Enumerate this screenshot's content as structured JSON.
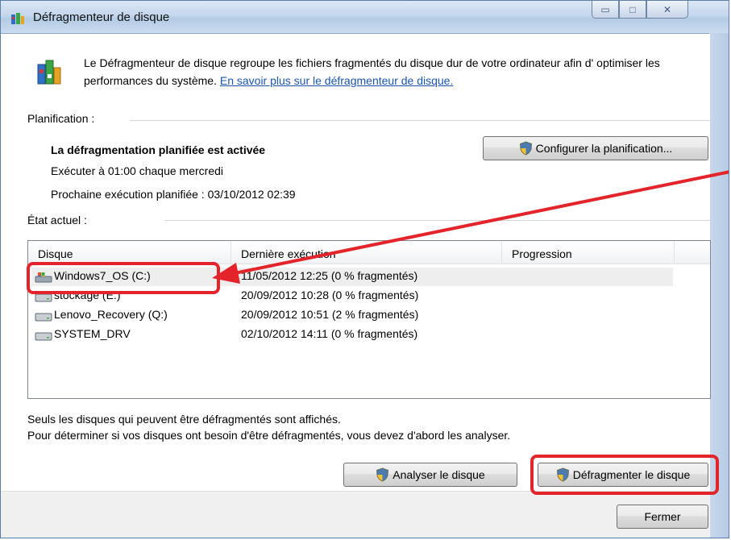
{
  "window": {
    "title": "Défragmenteur de disque",
    "controls": {
      "minimize": "▭",
      "maximize": "□",
      "close": "✕"
    }
  },
  "intro": {
    "text": "Le Défragmenteur de disque regroupe les fichiers fragmentés du disque dur de votre ordinateur afin d' optimiser les performances du système.",
    "link": "En savoir plus sur le défragmenteur de disque."
  },
  "schedule": {
    "label": "Planification :",
    "status": "La défragmentation planifiée est activée",
    "run_at": "Exécuter à 01:00 chaque mercredi",
    "next_run": "Prochaine exécution planifiée : 03/10/2012 02:39",
    "configure_button": "Configurer la planification..."
  },
  "current_state": {
    "label": "État actuel :",
    "columns": [
      "Disque",
      "Dernière exécution",
      "Progression"
    ],
    "rows": [
      {
        "disk": "Windows7_OS (C:)",
        "last_run": "11/05/2012 12:25 (0 % fragmentés)",
        "progress": "",
        "icon": "system-drive-icon",
        "selected": true
      },
      {
        "disk": "stockage (E:)",
        "last_run": "20/09/2012 10:28 (0 % fragmentés)",
        "progress": "",
        "icon": "drive-icon"
      },
      {
        "disk": "Lenovo_Recovery (Q:)",
        "last_run": "20/09/2012 10:51 (2 % fragmentés)",
        "progress": "",
        "icon": "drive-icon"
      },
      {
        "disk": "SYSTEM_DRV",
        "last_run": "02/10/2012 14:11 (0 % fragmentés)",
        "progress": "",
        "icon": "drive-icon"
      }
    ]
  },
  "notes": {
    "line1": "Seuls les disques qui peuvent être défragmentés sont affichés.",
    "line2": "Pour déterminer si vos disques ont besoin d'être défragmentés, vous devez d'abord les analyser."
  },
  "actions": {
    "analyze": "Analyser le disque",
    "defragment": "Défragmenter le disque",
    "close": "Fermer"
  },
  "colors": {
    "annotation": "#e3242b",
    "link": "#1a55b0",
    "titlebar": "#c5d7ec"
  }
}
